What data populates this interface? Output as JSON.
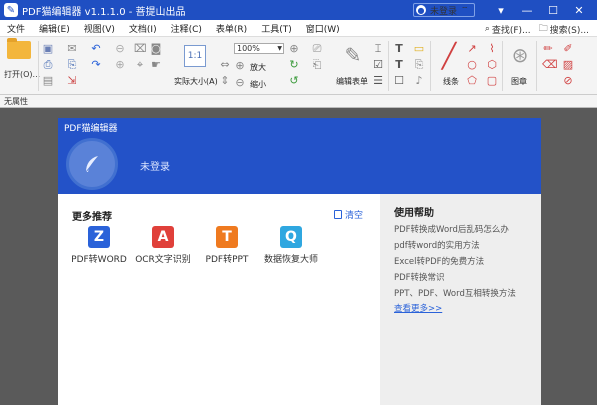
{
  "titlebar": {
    "title": "PDF猫编辑器 v1.1.1.0 - 菩提山出品",
    "login_text": "未登录"
  },
  "menu": {
    "items": [
      "文件",
      "编辑(E)",
      "视图(V)",
      "文档(I)",
      "注释(C)",
      "表单(R)",
      "工具(T)",
      "窗口(W)"
    ],
    "find_label": "查找(F)...",
    "search_label": "搜索(S)..."
  },
  "toolbar": {
    "open_label": "打开(O)...",
    "actual_size_label": "实际大小(A)",
    "zoom_value": "100%",
    "zoom_in_label": "放大",
    "zoom_out_label": "缩小",
    "edit_form_label": "编辑表单",
    "line_label": "线条",
    "shape_label": "图章"
  },
  "panel": {
    "label": "无属性"
  },
  "card": {
    "app_name": "PDF猫编辑器",
    "user_status": "未登录",
    "recommend": {
      "title": "更多推荐",
      "clear_label": "清空",
      "items": [
        {
          "label": "PDF转WORD",
          "glyph": "Z",
          "color": "#2a62d9"
        },
        {
          "label": "OCR文字识别",
          "glyph": "A",
          "color": "#e0403a"
        },
        {
          "label": "PDF转PPT",
          "glyph": "T",
          "color": "#ef7a1f"
        },
        {
          "label": "数据恢复大师",
          "glyph": "Q",
          "color": "#2fa7e0"
        }
      ]
    },
    "help": {
      "title": "使用帮助",
      "links": [
        "PDF转换成Word后乱码怎么办",
        "pdf转word的实用方法",
        "Excel转PDF的免费方法",
        "PDF转换常识",
        "PPT、PDF、Word互相转换方法"
      ],
      "more": "查看更多>>"
    }
  },
  "colors": {
    "brand": "#1f4fc2",
    "header": "#2352c8",
    "link": "#2a62d9"
  }
}
